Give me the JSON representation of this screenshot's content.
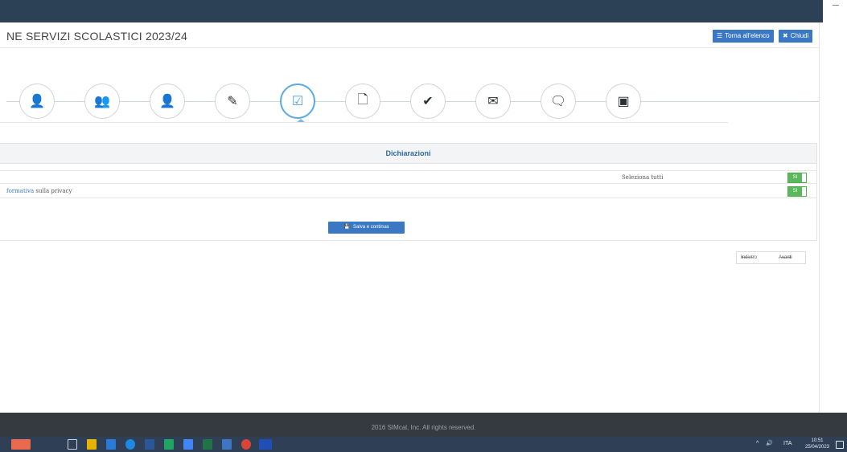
{
  "header": {
    "title": "NE SERVIZI SCOLASTICI 2023/24",
    "back_to_list_label": "Torna all'elenco",
    "close_label": "Chiudi"
  },
  "wizard": {
    "steps": [
      {
        "icon": "user-icon",
        "glyph": "👤"
      },
      {
        "icon": "group-icon",
        "glyph": "👥"
      },
      {
        "icon": "person-icon",
        "glyph": "👤"
      },
      {
        "icon": "pencil-icon",
        "glyph": "✎"
      },
      {
        "icon": "checkbox-icon",
        "glyph": "☑",
        "active": true
      },
      {
        "icon": "file-icon",
        "glyph": "🗋"
      },
      {
        "icon": "check-icon",
        "glyph": "✔"
      },
      {
        "icon": "envelope-icon",
        "glyph": "✉"
      },
      {
        "icon": "comment-icon",
        "glyph": "🗨"
      },
      {
        "icon": "archive-icon",
        "glyph": "▣"
      }
    ]
  },
  "panel": {
    "title": "Dichiarazioni",
    "select_all_label": "Seleziona tutti",
    "privacy_link": "formativa",
    "privacy_text": " sulla privacy",
    "toggle_on_label": "SI",
    "save_label": "Salva e continua"
  },
  "nav": {
    "back_label": "Indietro",
    "next_label": "Avanti"
  },
  "footer": {
    "text": "2016 SIMcal, Inc. All rights reserved."
  },
  "taskbar": {
    "tray_lang": "ITA",
    "tray_time": "10:51",
    "tray_date": "25/04/2023",
    "tray_arrow": "^",
    "tray_volume": "🔊"
  },
  "colors": {
    "primary": "#3a78c3",
    "success": "#5cb85c",
    "active_step": "#4b9fdc",
    "footer": "#343a40",
    "taskbar": "#2e3f56"
  }
}
